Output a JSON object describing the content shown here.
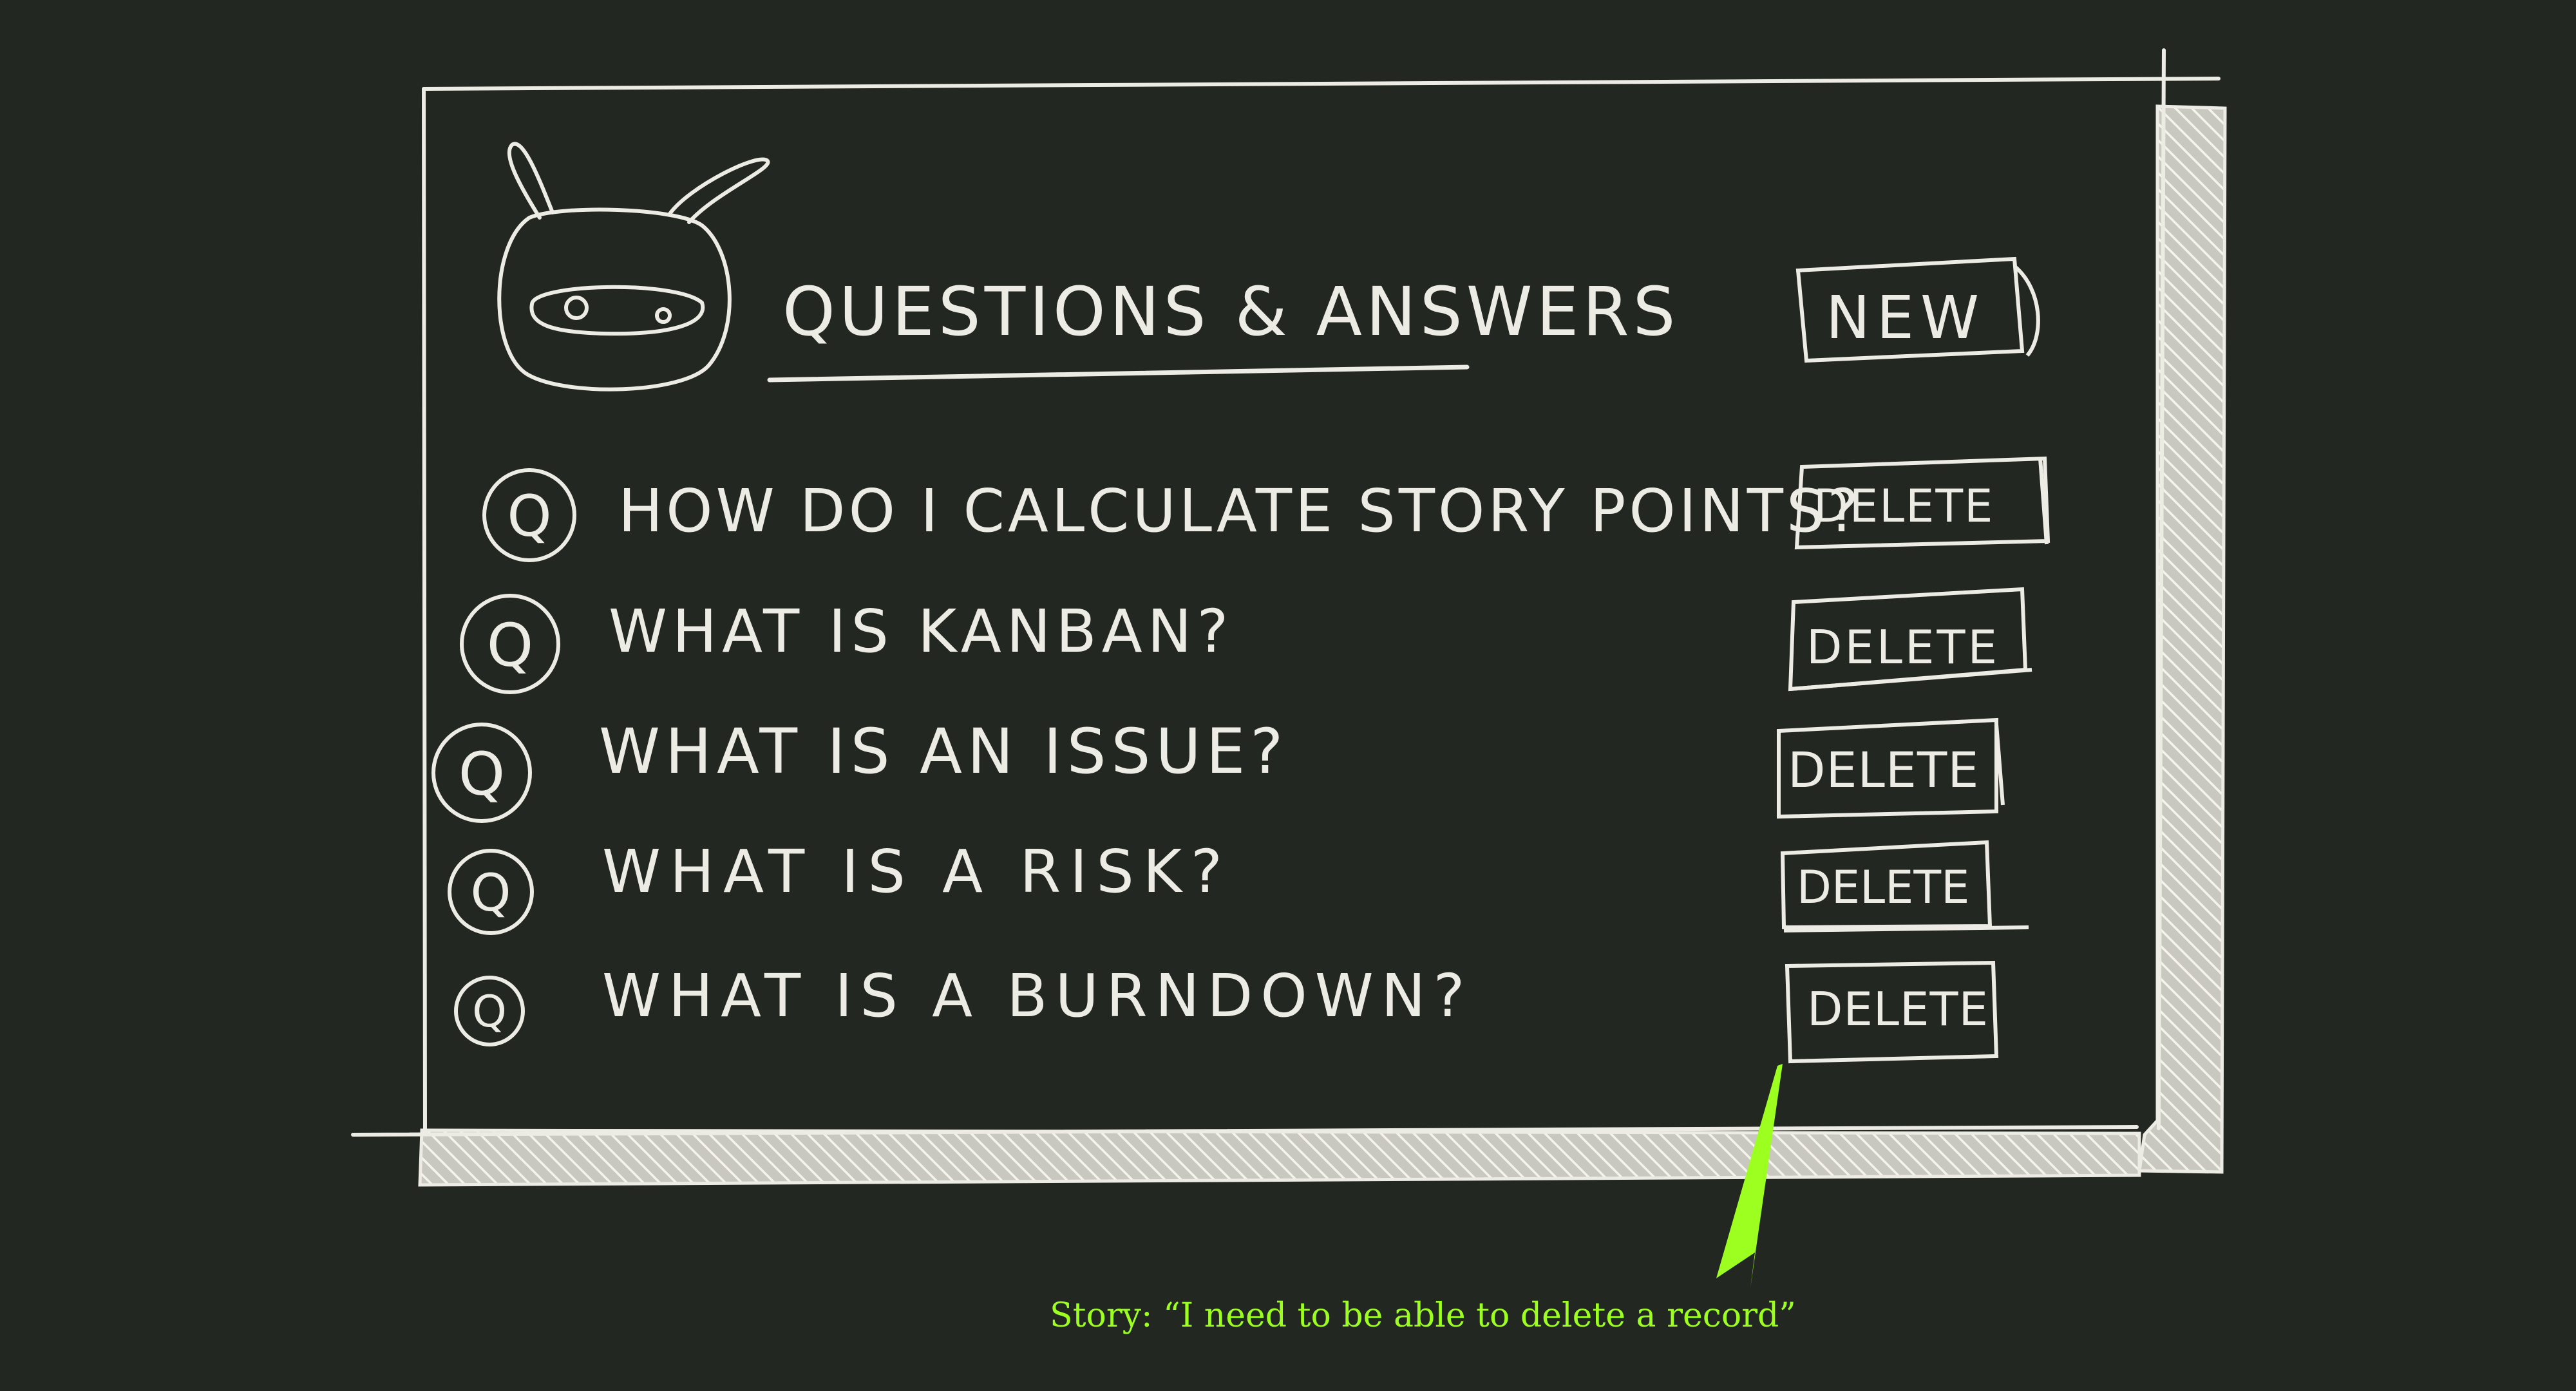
{
  "app": {
    "title": "QUESTIONS & ANSWERS",
    "logo": "ninja-bunny-icon"
  },
  "toolbar": {
    "new_label": "NEW"
  },
  "question_badge_label": "Q",
  "questions": [
    {
      "text": "HOW DO I CALCULATE STORY POINTS?",
      "delete_label": "DELETE"
    },
    {
      "text": "WHAT IS KANBAN?",
      "delete_label": "DELETE"
    },
    {
      "text": "WHAT IS AN ISSUE?",
      "delete_label": "DELETE"
    },
    {
      "text": "WHAT IS A RISK?",
      "delete_label": "DELETE"
    },
    {
      "text": "WHAT IS A BURNDOWN?",
      "delete_label": "DELETE"
    }
  ],
  "annotation": {
    "text": "Story: “I need to be able to delete a record”"
  },
  "colors": {
    "background": "#232722",
    "chalk": "#ecebe4",
    "annotation": "#9dff1f"
  }
}
